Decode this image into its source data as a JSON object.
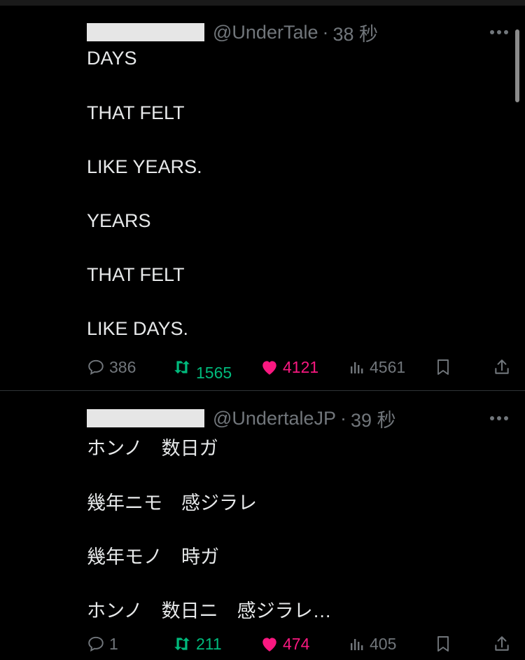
{
  "tweets": [
    {
      "handle": "@UnderTale",
      "separator": "·",
      "time": "38 秒",
      "lines": [
        "DAYS",
        "THAT FELT",
        "LIKE YEARS.",
        "YEARS",
        "THAT FELT",
        "LIKE DAYS."
      ],
      "replies": "386",
      "retweets": "1565",
      "likes": "4121",
      "views": "4561"
    },
    {
      "handle": "@UndertaleJP",
      "separator": "·",
      "time": "39 秒",
      "lines": [
        "ホンノ　数日ガ",
        "幾年ニモ　感ジラレ",
        "幾年モノ　時ガ",
        "ホンノ　数日ニ　感ジラレ…"
      ],
      "replies": "1",
      "retweets": "211",
      "likes": "474",
      "views": "405"
    }
  ],
  "icons": {
    "reply": "reply-icon",
    "retweet": "retweet-icon",
    "like": "heart-icon",
    "views": "views-icon",
    "bookmark": "bookmark-icon",
    "share": "share-icon",
    "more": "more-icon"
  },
  "colors": {
    "background": "#000000",
    "text": "#e7e9ea",
    "muted": "#71767b",
    "retweet": "#00ba7c",
    "like": "#f91880"
  }
}
